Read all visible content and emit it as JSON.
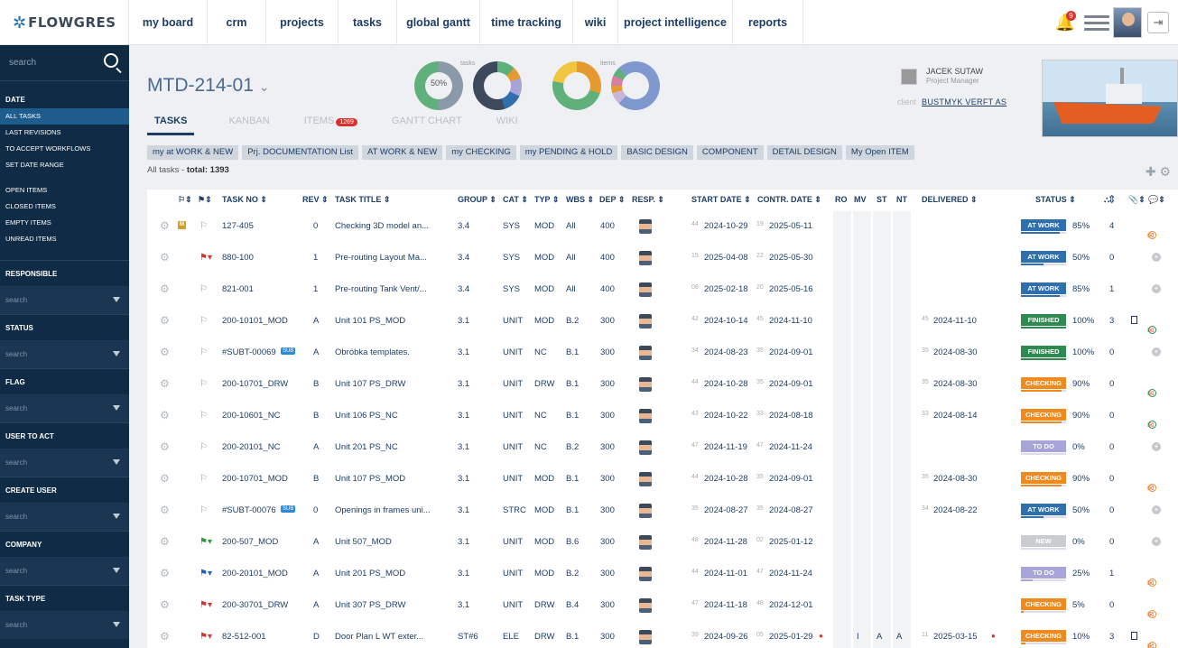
{
  "brand": {
    "name": "FLOWGRES"
  },
  "nav": [
    "my board",
    "crm",
    "projects",
    "tasks",
    "global gantt",
    "time tracking",
    "wiki",
    "project intelligence",
    "reports"
  ],
  "notifications": {
    "count": "9"
  },
  "sidebar": {
    "search_placeholder": "search",
    "date_head": "DATE",
    "date_items": [
      "ALL TASKS",
      "LAST REVISIONS",
      "TO ACCEPT WORKFLOWS",
      "SET DATE RANGE"
    ],
    "item_items": [
      "OPEN ITEMS",
      "CLOSED ITEMS",
      "EMPTY ITEMS",
      "UNREAD ITEMS"
    ],
    "filters": [
      "RESPONSIBLE",
      "STATUS",
      "FLAG",
      "USER TO ACT",
      "CREATE USER",
      "COMPANY",
      "TASK TYPE"
    ],
    "filter_placeholder": "search"
  },
  "project": {
    "code": "MTD-214-01",
    "tasks_label": "tasks",
    "items_label": "items",
    "donut_pct": "50%",
    "manager_name": "JACEK SUTAW",
    "manager_role": "Project Manager",
    "client_label": "client",
    "client_name": "BUSTMYK VERFT AS"
  },
  "tabs": [
    {
      "label": "TASKS",
      "active": true
    },
    {
      "label": "KANBAN"
    },
    {
      "label": "ITEMS",
      "badge": "1269"
    },
    {
      "label": "GANTT CHART"
    },
    {
      "label": "WIKI"
    }
  ],
  "filter_chips": [
    "my at WORK & NEW",
    "Prj. DOCUMENTATION List",
    "AT WORK & NEW",
    "my CHECKING",
    "my PENDING & HOLD",
    "BASIC DESIGN",
    "COMPONENT",
    "DETAIL DESIGN",
    "My Open ITEM"
  ],
  "summary": {
    "prefix": "All tasks - ",
    "total_label": "total: 1393"
  },
  "columns": {
    "task_no": "TASK NO ⇕",
    "rev": "REV ⇕",
    "title": "TASK TITLE ⇕",
    "group": "GROUP ⇕",
    "cat": "CAT ⇕",
    "typ": "TYP ⇕",
    "wbs": "WBS ⇕",
    "dep": "DEP ⇕",
    "resp": "RESP. ⇕",
    "start": "START DATE ⇕",
    "contr": "CONTR. DATE ⇕",
    "ro": "RO",
    "mv": "MV",
    "st": "ST",
    "nt": "NT",
    "delivered": "DELIVERED ⇕",
    "status": "STATUS ⇕"
  },
  "colors": {
    "at_work": "#2f6fae",
    "finished": "#2f8a52",
    "checking": "#ef8a1f",
    "todo": "#a6a4d8",
    "new": "#c9ccd1"
  },
  "rows": [
    {
      "flag": "outline",
      "m": "M",
      "task_no": "127-405",
      "rev": "0",
      "title": "Checking 3D model an...",
      "group": "3.4",
      "cat": "SYS",
      "typ": "MOD",
      "wbs": "All",
      "dep": "400",
      "sw": "44",
      "start": "2024-10-29",
      "cw": "19",
      "contr": "2025-05-11",
      "dw": "",
      "delivered": "",
      "status": "AT WORK",
      "st": "work",
      "pct": "85%",
      "p": 85,
      "cnt": "4",
      "icons": "mail-ring"
    },
    {
      "flag": "red",
      "task_no": "880-100",
      "rev": "1",
      "title": "Pre-routing Layout Ma...",
      "group": "3.4",
      "cat": "SYS",
      "typ": "MOD",
      "wbs": "All",
      "dep": "400",
      "sw": "15",
      "start": "2025-04-08",
      "cw": "22",
      "contr": "2025-05-30",
      "dw": "",
      "delivered": "",
      "status": "AT WORK",
      "st": "work",
      "pct": "50%",
      "p": 50,
      "cnt": "0",
      "icons": "plus"
    },
    {
      "flag": "outline",
      "task_no": "821-001",
      "rev": "1",
      "title": "Pre-routing Tank Vent/...",
      "group": "3.4",
      "cat": "SYS",
      "typ": "MOD",
      "wbs": "All",
      "dep": "400",
      "sw": "08",
      "start": "2025-02-18",
      "cw": "20",
      "contr": "2025-05-16",
      "dw": "",
      "delivered": "",
      "status": "AT WORK",
      "st": "work",
      "pct": "85%",
      "p": 85,
      "cnt": "1",
      "icons": "plus"
    },
    {
      "flag": "outline",
      "task_no": "200-10101_MOD",
      "rev": "A",
      "title": "Unit 101 PS_MOD",
      "group": "3.1",
      "cat": "UNIT",
      "typ": "MOD",
      "wbs": "B.2",
      "dep": "300",
      "sw": "42",
      "start": "2024-10-14",
      "cw": "45",
      "contr": "2024-11-10",
      "dw": "45",
      "delivered": "2024-11-10",
      "status": "FINISHED",
      "st": "fin",
      "pct": "100%",
      "p": 100,
      "cnt": "3",
      "icons": "doc-mail-ok"
    },
    {
      "flag": "outline",
      "task_no": "#SUBT-00069",
      "sub": "SUB",
      "rev": "A",
      "title": "Obróbka templates.",
      "group": "3.1",
      "cat": "UNIT",
      "typ": "NC",
      "wbs": "B.1",
      "dep": "300",
      "sw": "34",
      "start": "2024-08-23",
      "cw": "35",
      "contr": "2024-09-01",
      "dw": "35",
      "delivered": "2024-08-30",
      "status": "FINISHED",
      "st": "fin",
      "pct": "100%",
      "p": 100,
      "cnt": "0",
      "icons": "plus"
    },
    {
      "flag": "outline",
      "task_no": "200-10701_DRW",
      "rev": "B",
      "title": "Unit 107 PS_DRW",
      "group": "3.1",
      "cat": "UNIT",
      "typ": "DRW",
      "wbs": "B.1",
      "dep": "300",
      "sw": "44",
      "start": "2024-10-28",
      "cw": "35",
      "contr": "2024-09-01",
      "dw": "35",
      "delivered": "2024-08-30",
      "status": "CHECKING",
      "st": "chk",
      "pct": "90%",
      "p": 90,
      "cnt": "0",
      "icons": "mail-ok"
    },
    {
      "flag": "outline",
      "task_no": "200-10601_NC",
      "rev": "B",
      "title": "Unit 106 PS_NC",
      "group": "3.1",
      "cat": "UNIT",
      "typ": "NC",
      "wbs": "B.1",
      "dep": "300",
      "sw": "43",
      "start": "2024-10-22",
      "cw": "33",
      "contr": "2024-08-18",
      "dw": "33",
      "delivered": "2024-08-14",
      "status": "CHECKING",
      "st": "chk",
      "pct": "90%",
      "p": 90,
      "cnt": "0",
      "icons": "mail-ok"
    },
    {
      "flag": "outline",
      "task_no": "200-20101_NC",
      "rev": "A",
      "title": "Unit 201 PS_NC",
      "group": "3.1",
      "cat": "UNIT",
      "typ": "NC",
      "wbs": "B.2",
      "dep": "300",
      "sw": "47",
      "start": "2024-11-19",
      "cw": "47",
      "contr": "2024-11-24",
      "dw": "",
      "delivered": "",
      "status": "TO DO",
      "st": "todo",
      "pct": "0%",
      "p": 0,
      "cnt": "0",
      "icons": "plus"
    },
    {
      "flag": "outline",
      "task_no": "200-10701_MOD",
      "rev": "B",
      "title": "Unit 107 PS_MOD",
      "group": "3.1",
      "cat": "UNIT",
      "typ": "MOD",
      "wbs": "B.1",
      "dep": "300",
      "sw": "44",
      "start": "2024-10-28",
      "cw": "35",
      "contr": "2024-09-01",
      "dw": "35",
      "delivered": "2024-08-30",
      "status": "CHECKING",
      "st": "chk",
      "pct": "90%",
      "p": 90,
      "cnt": "0",
      "icons": "mail-ring"
    },
    {
      "flag": "outline",
      "task_no": "#SUBT-00076",
      "sub": "SUB",
      "rev": "0",
      "title": "Openings in frames uni...",
      "group": "3.1",
      "cat": "STRC",
      "typ": "MOD",
      "wbs": "B.1",
      "dep": "300",
      "sw": "35",
      "start": "2024-08-27",
      "cw": "35",
      "contr": "2024-08-27",
      "dw": "34",
      "delivered": "2024-08-22",
      "status": "AT WORK",
      "st": "work",
      "pct": "50%",
      "p": 50,
      "cnt": "0",
      "icons": "plus"
    },
    {
      "flag": "green",
      "task_no": "200-507_MOD",
      "rev": "A",
      "title": "Unit 507_MOD",
      "group": "3.1",
      "cat": "UNIT",
      "typ": "MOD",
      "wbs": "B.6",
      "dep": "300",
      "sw": "48",
      "start": "2024-11-28",
      "cw": "02",
      "contr": "2025-01-12",
      "dw": "",
      "delivered": "",
      "status": "NEW",
      "st": "new",
      "pct": "0%",
      "p": 0,
      "cnt": "0",
      "icons": "plus"
    },
    {
      "flag": "blue",
      "task_no": "200-20101_MOD",
      "rev": "A",
      "title": "Unit 201 PS_MOD",
      "group": "3.1",
      "cat": "UNIT",
      "typ": "MOD",
      "wbs": "B.2",
      "dep": "300",
      "sw": "44",
      "start": "2024-11-01",
      "cw": "47",
      "contr": "2024-11-24",
      "dw": "",
      "delivered": "",
      "status": "TO DO",
      "st": "todo",
      "pct": "25%",
      "p": 25,
      "cnt": "1",
      "icons": "mail-ring"
    },
    {
      "flag": "red",
      "task_no": "200-30701_DRW",
      "rev": "A",
      "title": "Unit 307 PS_DRW",
      "group": "3.1",
      "cat": "UNIT",
      "typ": "DRW",
      "wbs": "B.4",
      "dep": "300",
      "sw": "47",
      "start": "2024-11-18",
      "cw": "48",
      "contr": "2024-12-01",
      "dw": "",
      "delivered": "",
      "status": "CHECKING",
      "st": "chk",
      "pct": "5%",
      "p": 5,
      "cnt": "0",
      "icons": "mail-ring"
    },
    {
      "flag": "red",
      "task_no": "82-512-001",
      "rev": "D",
      "title": "Door Plan L WT exter...",
      "group": "ST#6",
      "cat": "ELE",
      "typ": "DRW",
      "wbs": "B.1",
      "dep": "300",
      "sw": "39",
      "start": "2024-09-26",
      "cw": "05",
      "contr": "2025-01-29",
      "alert": true,
      "ro": "I",
      "mv": "A",
      "st2": "A",
      "dw": "11",
      "delivered": "2025-03-15",
      "dalert": true,
      "status": "CHECKING",
      "st": "chk",
      "pct": "10%",
      "p": 10,
      "cnt": "3",
      "icons": "doc-mail-ring"
    }
  ]
}
